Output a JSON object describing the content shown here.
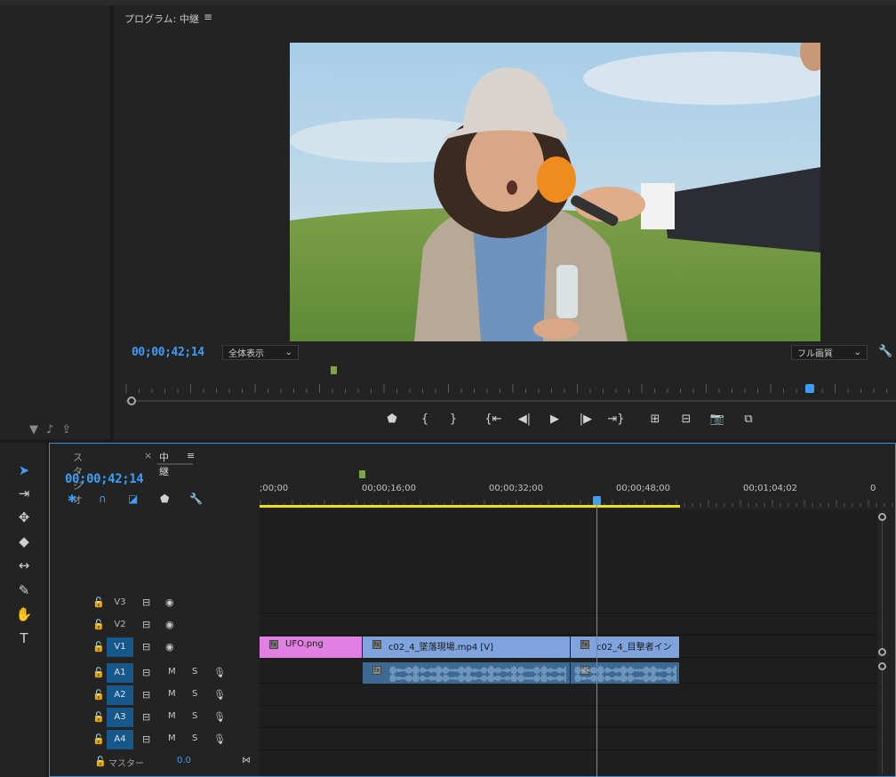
{
  "program_monitor": {
    "title": "プログラム: 中継",
    "menu_icon": "≡",
    "timecode": "00;00;42;14",
    "fit_label": "全体表示",
    "resolution_label": "フル画質",
    "transport": [
      {
        "name": "add-marker-icon",
        "glyph": "⬟"
      },
      {
        "name": "mark-in-icon",
        "glyph": "{"
      },
      {
        "name": "mark-out-icon",
        "glyph": "}"
      },
      {
        "name": "go-to-in-icon",
        "glyph": "{⇤"
      },
      {
        "name": "step-back-icon",
        "glyph": "◀|"
      },
      {
        "name": "play-icon",
        "glyph": "▶"
      },
      {
        "name": "step-forward-icon",
        "glyph": "|▶"
      },
      {
        "name": "go-to-out-icon",
        "glyph": "⇥}"
      },
      {
        "name": "lift-icon",
        "glyph": "⊞"
      },
      {
        "name": "extract-icon",
        "glyph": "⊟"
      },
      {
        "name": "export-frame-icon",
        "glyph": "📷"
      },
      {
        "name": "comparison-view-icon",
        "glyph": "⧉"
      }
    ]
  },
  "timeline": {
    "tabs": [
      {
        "label": "スタジオ",
        "active": false
      },
      {
        "label": "中継",
        "active": true
      }
    ],
    "close_glyph": "×",
    "menu_icon": "≡",
    "timecode": "00;00;42;14",
    "ruler_labels": [
      ";00;00",
      "00;00;16;00",
      "00;00;32;00",
      "00;00;48;00",
      "00;01;04;02",
      "0"
    ],
    "video_tracks": [
      {
        "name": "V3",
        "targeted": false
      },
      {
        "name": "V2",
        "targeted": false
      },
      {
        "name": "V1",
        "targeted": true
      }
    ],
    "audio_tracks": [
      {
        "name": "A1",
        "targeted": true
      },
      {
        "name": "A2",
        "targeted": true
      },
      {
        "name": "A3",
        "targeted": true
      },
      {
        "name": "A4",
        "targeted": true
      }
    ],
    "mute_label": "M",
    "solo_label": "S",
    "master_label": "マスター",
    "master_value": "0.0",
    "clips": {
      "ufo": "UFO.png",
      "v1_main": "c02_4_墜落現場.mp4 [V]",
      "v1_second": "c02_4_目撃者イン"
    }
  },
  "colors": {
    "accent_blue": "#3b9df6",
    "clip_video": "#7ea3dd",
    "clip_audio": "#3e6993",
    "clip_image": "#e27fe2",
    "workarea": "#e6e21e",
    "marker": "#7ea34a"
  }
}
